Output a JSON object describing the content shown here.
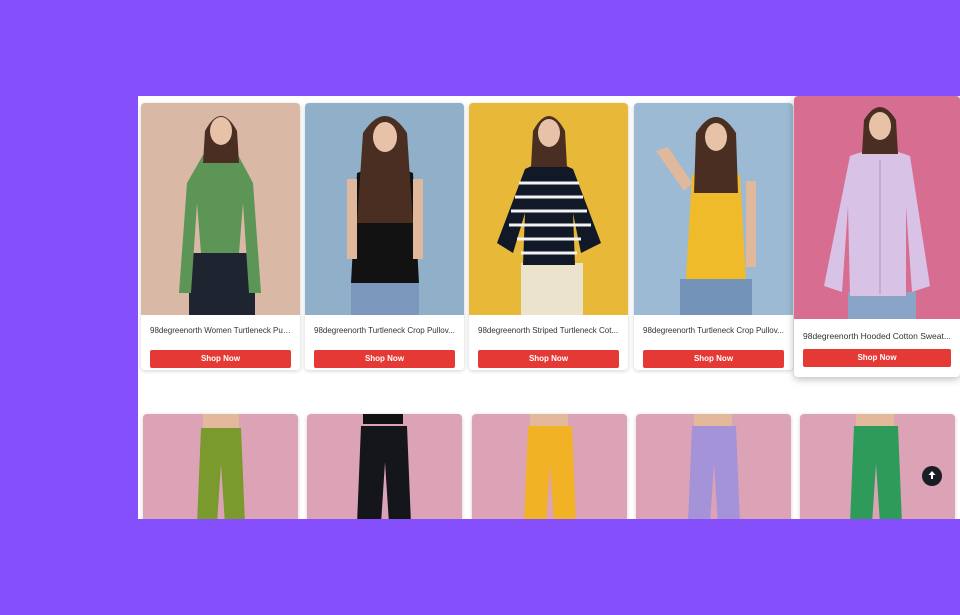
{
  "products": [
    {
      "title": "98degreenorth Women Turtleneck Pul...",
      "cta": "Shop Now"
    },
    {
      "title": "98degreenorth Turtleneck Crop Pullov...",
      "cta": "Shop Now"
    },
    {
      "title": "98degreenorth Striped Turtleneck Cot...",
      "cta": "Shop Now"
    },
    {
      "title": "98degreenorth Turtleneck Crop Pullov...",
      "cta": "Shop Now"
    },
    {
      "title": "98degreenorth Hooded Cotton Sweat...",
      "cta": "Shop Now"
    }
  ],
  "colors": {
    "page_bg": "#8550fb",
    "button": "#e53935",
    "photo_backgrounds": [
      "#d9b8a6",
      "#8fb0c8",
      "#e8b938",
      "#9cbad4",
      "#d86d92"
    ],
    "garments": [
      "#5c9555",
      "#121212",
      "#111827",
      "#efbb2a",
      "#d8c3e6"
    ],
    "pants": [
      "#7a9a2e",
      "#15151c",
      "#f1b225",
      "#a493d8",
      "#2f9b5b"
    ]
  },
  "icons": {
    "scroll_top": "arrow-up-icon"
  }
}
